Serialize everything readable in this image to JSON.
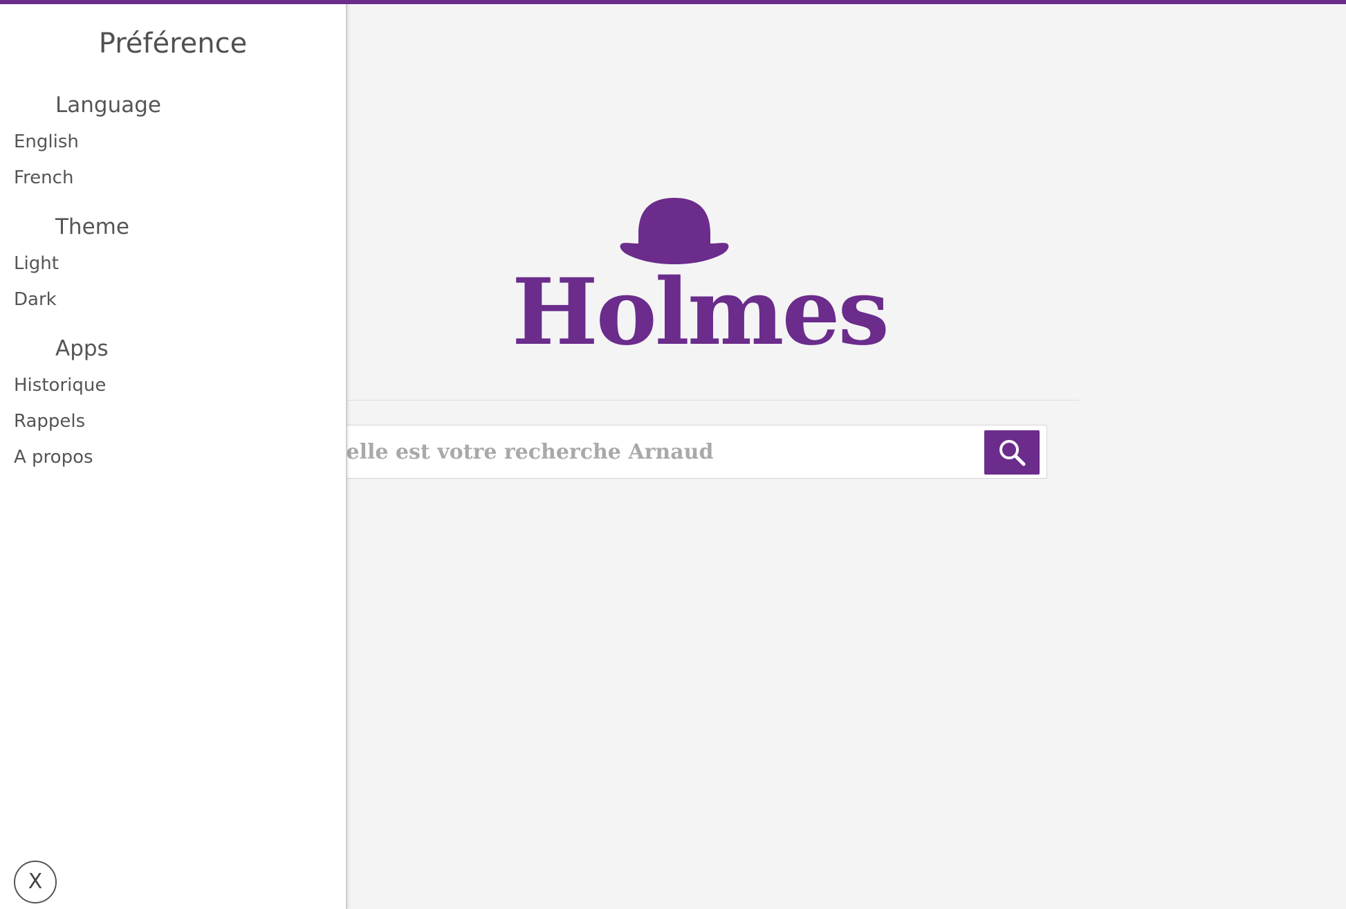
{
  "brand": {
    "name": "Holmes",
    "accent_color": "#6b2c8c"
  },
  "sidebar": {
    "title": "Préférence",
    "sections": [
      {
        "heading": "Language",
        "items": [
          "English",
          "French"
        ]
      },
      {
        "heading": "Theme",
        "items": [
          "Light",
          "Dark"
        ]
      },
      {
        "heading": "Apps",
        "items": [
          "Historique",
          "Rappels",
          "A propos"
        ]
      }
    ],
    "close_label": "X"
  },
  "search": {
    "placeholder": "Quelle est votre recherche Arnaud?",
    "value": "",
    "button_icon": "search-icon"
  }
}
